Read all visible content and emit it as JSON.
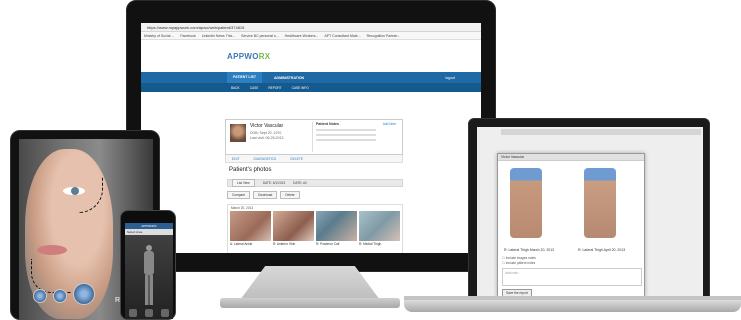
{
  "browser": {
    "address": "https://www.myappwork.com/apwo/web/patient/374815",
    "bookmarks": [
      "Ministry of Social ...",
      "Facebook",
      "LinkedIn News This...",
      "Service BC personal s...",
      "Healthcare Workers...",
      "APT Consultant Mate...",
      "Recognition Partner..."
    ]
  },
  "app": {
    "logo_text": "APPWO",
    "logo_accent": "RX",
    "nav": {
      "patient_list": "PATIENT LIST",
      "administration": "ADMINISTRATION",
      "logout": "logout"
    },
    "subnav": [
      "BACK",
      "CASE",
      "REPORT",
      "CASE INFO"
    ],
    "patient": {
      "name": "Victor Vascular",
      "dob": "DOB: Sept 20, 1970",
      "last_visit": "Last visit: 06-25-2013",
      "notes_title": "Patient Notes",
      "notes_add": "Add Note"
    },
    "actions": [
      "EDIT",
      "DIAGNOSTICS",
      "DELETE"
    ],
    "photos_title": "Patient's photos",
    "filter": {
      "view": "List View",
      "date_from": "DATE:  6/1/2013",
      "date_to": "DATE:  All"
    },
    "buttons": [
      "Compare",
      "Download",
      "Delete"
    ],
    "gallery_date": "March 20, 2013",
    "thumbs": [
      "A: Lateral Ankle",
      "R: Anterior Shin",
      "R: Posterior Calf",
      "R: Medial Thigh"
    ]
  },
  "laptop": {
    "modal_title": "Victor Vascular",
    "captions": [
      "R: Lateral Thigh March 20, 2013",
      "R: Lateral Thigh April 20, 2013"
    ],
    "checks": [
      "Include images notes",
      "Include patient notes"
    ],
    "note_placeholder": "Add note...",
    "save_label": "Save the report"
  },
  "tablet": {
    "label": "R: Full"
  },
  "phone": {
    "title": "APPWORX",
    "subtitle": "Select Area"
  }
}
